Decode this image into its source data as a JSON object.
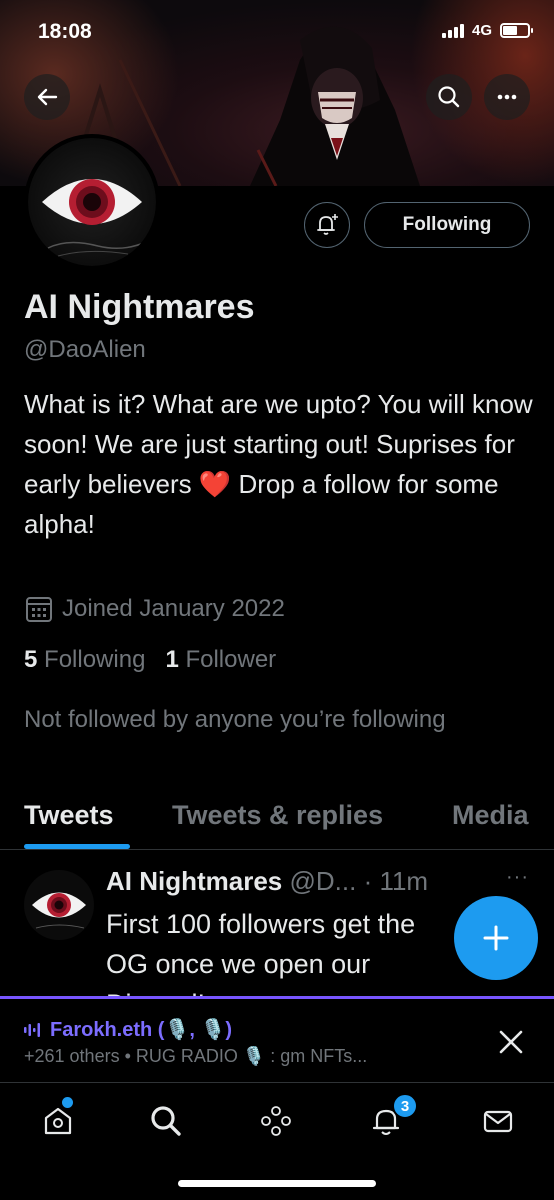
{
  "status": {
    "time": "18:08",
    "network": "4G"
  },
  "profile": {
    "name": "AI Nightmares",
    "handle": "@DaoAlien",
    "bio": "What is it? What are we upto? You will know soon! We are just starting out! Suprises for early believers ❤️ Drop a follow for some alpha!",
    "joined": "Joined January 2022",
    "following_count": "5",
    "following_label": "Following",
    "followers_count": "1",
    "followers_label": "Follower",
    "not_followed": "Not followed by anyone you’re following",
    "follow_button": "Following"
  },
  "tabs": [
    {
      "label": "Tweets",
      "active": true
    },
    {
      "label": "Tweets & replies",
      "active": false
    },
    {
      "label": "Media",
      "active": false
    }
  ],
  "tweet": {
    "name": "AI Nightmares",
    "meta": "@D... · 11m",
    "more": "···",
    "text_lines": [
      "First 100 followers get the",
      "OG once we open our",
      "Discord!"
    ]
  },
  "space": {
    "host": "Farokh.eth (🎙️, 🎙️)",
    "detail": "+261 others • RUG RADIO 🎙️ : gm NFTs..."
  },
  "nav": {
    "notifications_badge": "3"
  },
  "colors": {
    "accent": "#1d9bf0",
    "space": "#7856ff",
    "muted": "#71767b"
  }
}
